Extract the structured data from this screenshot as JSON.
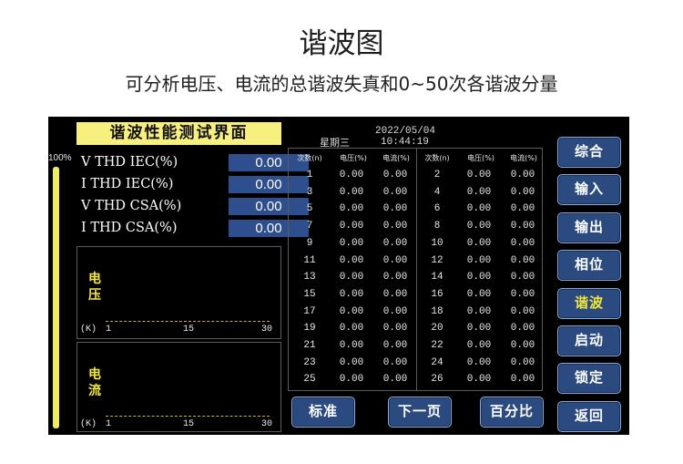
{
  "page": {
    "title": "谐波图",
    "subtitle": "可分析电压、电流的总谐波失真和0~50次各谐波分量"
  },
  "device": {
    "panel_title": "谐波性能测试界面",
    "level_bar": {
      "label": "100%",
      "fill_fraction": 1.0
    },
    "thd_rows": [
      {
        "label": "V THD IEC(%)",
        "value": "0.00"
      },
      {
        "label": "I THD IEC(%)",
        "value": "0.00"
      },
      {
        "label": "V THD CSA(%)",
        "value": "0.00"
      },
      {
        "label": "I THD CSA(%)",
        "value": "0.00"
      }
    ],
    "voltage_chart": {
      "label_line1": "电",
      "label_line2": "压",
      "unit": "(K)",
      "ticks": [
        "1",
        "15",
        "30"
      ]
    },
    "current_chart": {
      "label_line1": "电",
      "label_line2": "流",
      "unit": "(K)",
      "ticks": [
        "1",
        "15",
        "30"
      ]
    },
    "date": "2022/05/04",
    "time": "10:44:19",
    "weekday": "星期三",
    "table": {
      "headers": [
        "次数(n)",
        "电压(%)",
        "电流(%)",
        "次数(n)",
        "电压(%)",
        "电流(%)"
      ],
      "left": [
        {
          "n": "1",
          "v": "0.00",
          "i": "0.00"
        },
        {
          "n": "3",
          "v": "0.00",
          "i": "0.00"
        },
        {
          "n": "5",
          "v": "0.00",
          "i": "0.00"
        },
        {
          "n": "7",
          "v": "0.00",
          "i": "0.00"
        },
        {
          "n": "9",
          "v": "0.00",
          "i": "0.00"
        },
        {
          "n": "11",
          "v": "0.00",
          "i": "0.00"
        },
        {
          "n": "13",
          "v": "0.00",
          "i": "0.00"
        },
        {
          "n": "15",
          "v": "0.00",
          "i": "0.00"
        },
        {
          "n": "17",
          "v": "0.00",
          "i": "0.00"
        },
        {
          "n": "19",
          "v": "0.00",
          "i": "0.00"
        },
        {
          "n": "21",
          "v": "0.00",
          "i": "0.00"
        },
        {
          "n": "23",
          "v": "0.00",
          "i": "0.00"
        },
        {
          "n": "25",
          "v": "0.00",
          "i": "0.00"
        }
      ],
      "right": [
        {
          "n": "2",
          "v": "0.00",
          "i": "0.00"
        },
        {
          "n": "4",
          "v": "0.00",
          "i": "0.00"
        },
        {
          "n": "6",
          "v": "0.00",
          "i": "0.00"
        },
        {
          "n": "8",
          "v": "0.00",
          "i": "0.00"
        },
        {
          "n": "10",
          "v": "0.00",
          "i": "0.00"
        },
        {
          "n": "12",
          "v": "0.00",
          "i": "0.00"
        },
        {
          "n": "14",
          "v": "0.00",
          "i": "0.00"
        },
        {
          "n": "16",
          "v": "0.00",
          "i": "0.00"
        },
        {
          "n": "18",
          "v": "0.00",
          "i": "0.00"
        },
        {
          "n": "20",
          "v": "0.00",
          "i": "0.00"
        },
        {
          "n": "22",
          "v": "0.00",
          "i": "0.00"
        },
        {
          "n": "24",
          "v": "0.00",
          "i": "0.00"
        },
        {
          "n": "26",
          "v": "0.00",
          "i": "0.00"
        }
      ]
    },
    "side_buttons": [
      {
        "label": "综合",
        "active": false
      },
      {
        "label": "输入",
        "active": false
      },
      {
        "label": "输出",
        "active": false
      },
      {
        "label": "相位",
        "active": false
      },
      {
        "label": "谐波",
        "active": true
      },
      {
        "label": "启动",
        "active": false
      },
      {
        "label": "锁定",
        "active": false
      },
      {
        "label": "返回",
        "active": false
      }
    ],
    "bottom_buttons": [
      "标准",
      "下一页",
      "百分比"
    ]
  }
}
